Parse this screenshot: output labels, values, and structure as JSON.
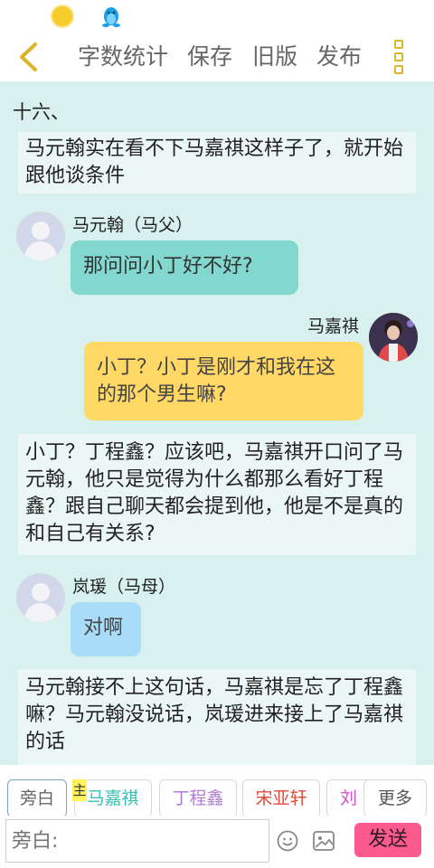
{
  "toolbar": {
    "word_count": "字数统计",
    "save": "保存",
    "old_version": "旧版",
    "publish": "发布"
  },
  "story": {
    "chapter": "十六、",
    "narration_1": "马元翰实在看不下马嘉祺这样子了，就开始跟他谈条件",
    "msg_1": {
      "speaker": "马元翰（马父）",
      "text": "那问问小丁好不好?"
    },
    "msg_2": {
      "speaker": "马嘉祺",
      "text": "小丁？小丁是刚才和我在这的那个男生嘛?"
    },
    "narration_2": "小丁？丁程鑫？应该吧，马嘉祺开口问了马元翰，他只是觉得为什么都那么看好丁程鑫？跟自己聊天都会提到他，他是不是真的和自己有关系?",
    "msg_3": {
      "speaker": "岚瑗（马母）",
      "text": "对啊"
    },
    "narration_3": "马元翰接不上这句话，马嘉祺是忘了丁程鑫嘛？马元翰没说话，岚瑗进来接上了马嘉祺的话"
  },
  "roles": {
    "narrator": "旁白",
    "main_badge": "主",
    "ma_jiaqi": "马嘉祺",
    "ding_chengxin": "丁程鑫",
    "song_yaxuan": "宋亚轩",
    "liu": "刘",
    "more": "更多"
  },
  "input": {
    "placeholder": "旁白:",
    "send": "发送"
  },
  "colors": {
    "bg": "#d9f1ee",
    "teal_bubble": "#82d8cf",
    "yellow_bubble": "#ffd866",
    "blue_bubble": "#a9dcf9",
    "send": "#fb5a8e"
  }
}
